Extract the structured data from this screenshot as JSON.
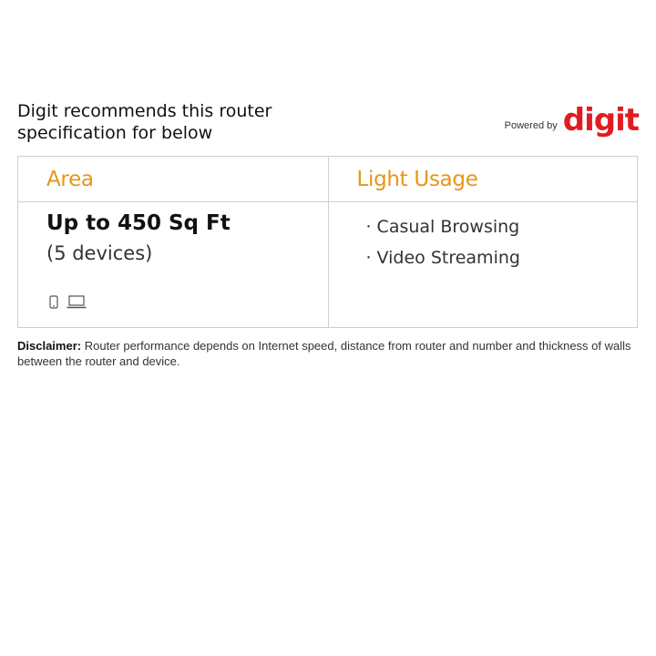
{
  "header": {
    "title_line1": "Digit recommends this router",
    "title_line2": "specification for below",
    "powered_by": "Powered by",
    "brand_logo": "digit"
  },
  "table": {
    "area": {
      "heading": "Area",
      "value": "Up to 450 Sq Ft",
      "devices": "(5 devices)",
      "icons": [
        "phone-icon",
        "laptop-icon"
      ]
    },
    "usage": {
      "heading": "Light Usage",
      "items": [
        "Casual Browsing",
        "Video Streaming"
      ]
    }
  },
  "disclaimer": {
    "label": "Disclaimer:",
    "text": "Router performance depends on Internet speed, distance from router and number and thickness of walls between the router and device."
  },
  "colors": {
    "accent_heading": "#e8951a",
    "brand_red": "#e21b22",
    "border": "#cfcfcf"
  }
}
